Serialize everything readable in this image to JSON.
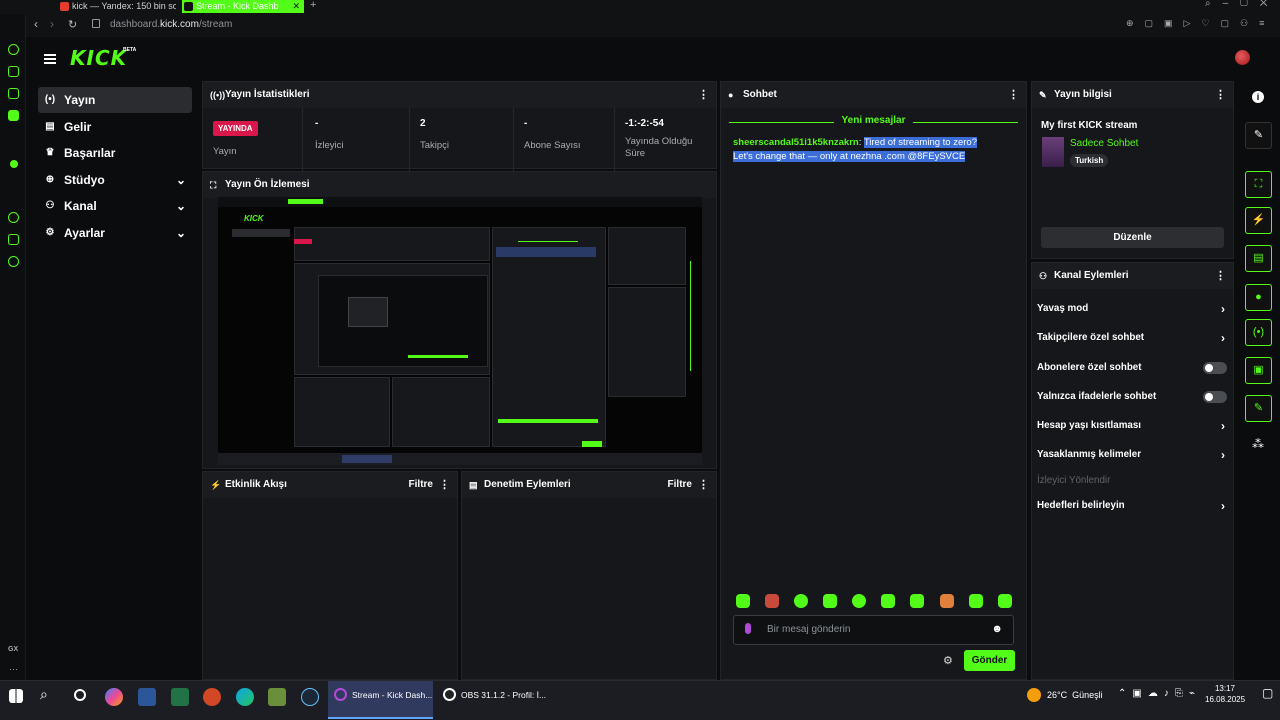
{
  "browser": {
    "tabs": [
      {
        "label": "kick — Yandex: 150 bin so"
      },
      {
        "label": "Stream - Kick Dashb"
      }
    ],
    "url_prefix": "dashboard.",
    "url_domain": "kick.com",
    "url_path": "/stream"
  },
  "header": {
    "logo": "KICK",
    "beta": "BETA"
  },
  "nav": {
    "items": [
      {
        "label": "Yayın"
      },
      {
        "label": "Gelir"
      },
      {
        "label": "Başarılar"
      },
      {
        "label": "Stüdyo"
      },
      {
        "label": "Kanal"
      },
      {
        "label": "Ayarlar"
      }
    ]
  },
  "stats": {
    "title": "Yayın İstatistikleri",
    "live_badge": "YAYINDA",
    "live_label": "Yayın",
    "viewers_value": "-",
    "viewers_label": "İzleyici",
    "followers_value": "2",
    "followers_label": "Takipçi",
    "subs_value": "-",
    "subs_label": "Abone Sayısı",
    "duration_value": "-1:-2:-54",
    "duration_label": "Yayında Olduğu Süre"
  },
  "preview": {
    "title": "Yayın Ön İzlemesi"
  },
  "activity": {
    "title": "Etkinlik Akışı",
    "filter": "Filtre"
  },
  "moderation": {
    "title": "Denetim Eylemleri",
    "filter": "Filtre"
  },
  "chat": {
    "title": "Sohbet",
    "new_messages": "Yeni mesajlar",
    "message_user": "sheerscandal51i1k5knzakrn",
    "message_text": "Tired of streaming to zero? Let's change that — only at nezhna .com @8FEySVCE",
    "input_placeholder": "Bir mesaj gönderin",
    "send_label": "Gönder"
  },
  "stream_info": {
    "title": "Yayın bilgisi",
    "stream_title": "My first KICK stream",
    "category": "Sadece Sohbet",
    "language": "Turkish",
    "edit_label": "Düzenle"
  },
  "channel_actions": {
    "title": "Kanal Eylemleri",
    "items": [
      {
        "label": "Yavaş mod"
      },
      {
        "label": "Takipçilere özel sohbet"
      },
      {
        "label": "Abonelere özel sohbet"
      },
      {
        "label": "Yalnızca ifadelerle sohbet"
      },
      {
        "label": "Hesap yaşı kısıtlaması"
      },
      {
        "label": "Yasaklanmış kelimeler"
      },
      {
        "label": "İzleyici Yönlendir"
      },
      {
        "label": "Hedefleri belirleyin"
      }
    ]
  },
  "taskbar": {
    "apps": [
      {
        "label": "Stream - Kick Dash..."
      },
      {
        "label": "OBS 31.1.2 - Profil: İ..."
      }
    ],
    "weather": "26°C  Güneşli",
    "time": "13:17",
    "date": "16.08.2025",
    "gx_label": "GX"
  },
  "colors": {
    "accent": "#53fc18",
    "live": "#d9174b",
    "panel": "#16171a"
  }
}
